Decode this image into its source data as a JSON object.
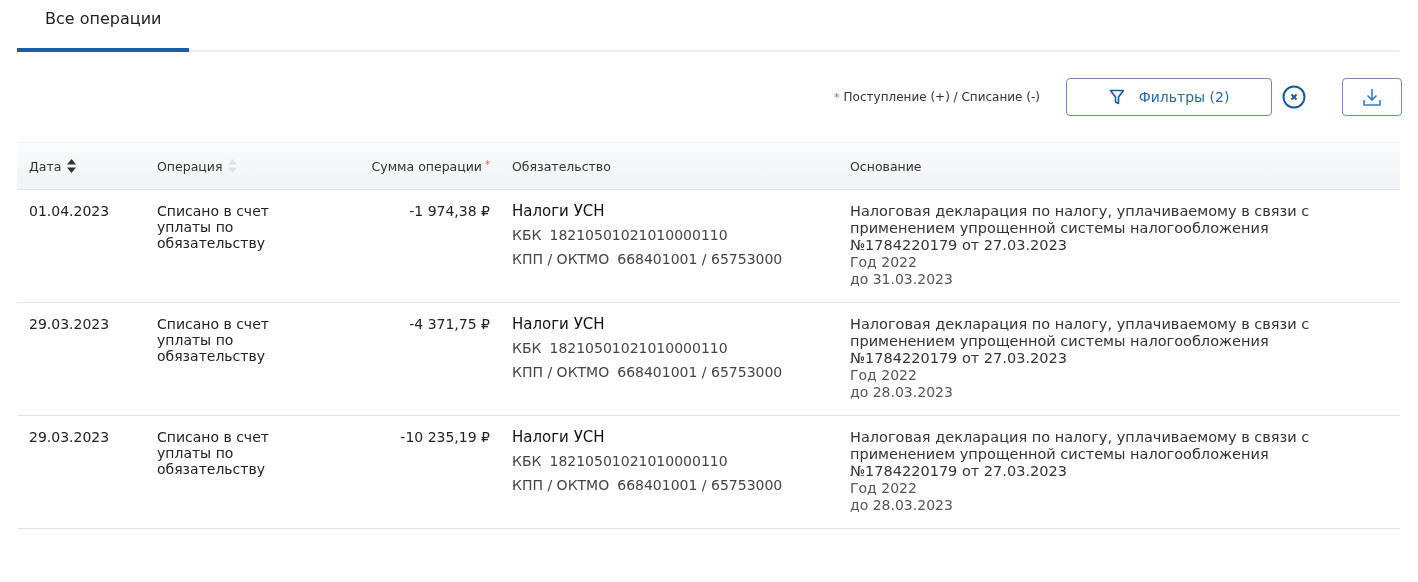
{
  "tabs": [
    {
      "label": "Все операции",
      "selected": true
    }
  ],
  "toolbar": {
    "legend_mark": "*",
    "legend": "Поступление (+) / Списание (-)",
    "filter_button": "Фильтры (2)",
    "filters_active": true
  },
  "table": {
    "columns": [
      {
        "label": "Дата",
        "kind": "sortable",
        "sorted": true
      },
      {
        "label": "Операция",
        "kind": "sortable",
        "sorted": false
      },
      {
        "label": "Сумма операции",
        "kind": "amount",
        "required_mark": "*"
      },
      {
        "label": "Обязательство",
        "kind": "plain"
      },
      {
        "label": "Основание",
        "kind": "plain"
      }
    ],
    "rows": [
      {
        "date": "01.04.2023",
        "operation": "Списано в счет уплаты по обязательству",
        "amount": "-1 974,38 ₽",
        "obligation": "Налоги УСН",
        "kbk_label": "КБК",
        "kbk": "18210501021010000110",
        "kpp_label": "КПП / ОКТМО",
        "kpp": "668401001 / 65753000",
        "basis": "Налоговая декларация по налогу, уплачиваемому в связи с применением упрощенной системы налогообложения №1784220179 от 27.03.2023",
        "year": "Год 2022",
        "due": "до 31.03.2023"
      },
      {
        "date": "29.03.2023",
        "operation": "Списано в счет уплаты по обязательству",
        "amount": "-4 371,75 ₽",
        "obligation": "Налоги УСН",
        "kbk_label": "КБК",
        "kbk": "18210501021010000110",
        "kpp_label": "КПП / ОКТМО",
        "kpp": "668401001 / 65753000",
        "basis": "Налоговая декларация по налогу, уплачиваемому в связи с применением упрощенной системы налогообложения №1784220179 от 27.03.2023",
        "year": "Год 2022",
        "due": "до 28.03.2023"
      },
      {
        "date": "29.03.2023",
        "operation": "Списано в счет уплаты по обязательству",
        "amount": "-10 235,19 ₽",
        "obligation": "Налоги УСН",
        "kbk_label": "КБК",
        "kbk": "18210501021010000110",
        "kpp_label": "КПП / ОКТМО",
        "kpp": "668401001 / 65753000",
        "basis": "Налоговая декларация по налогу, уплачиваемому в связи с применением упрощенной системы налогообложения №1784220179 от 27.03.2023",
        "year": "Год 2022",
        "due": "до 28.03.2023"
      }
    ]
  }
}
